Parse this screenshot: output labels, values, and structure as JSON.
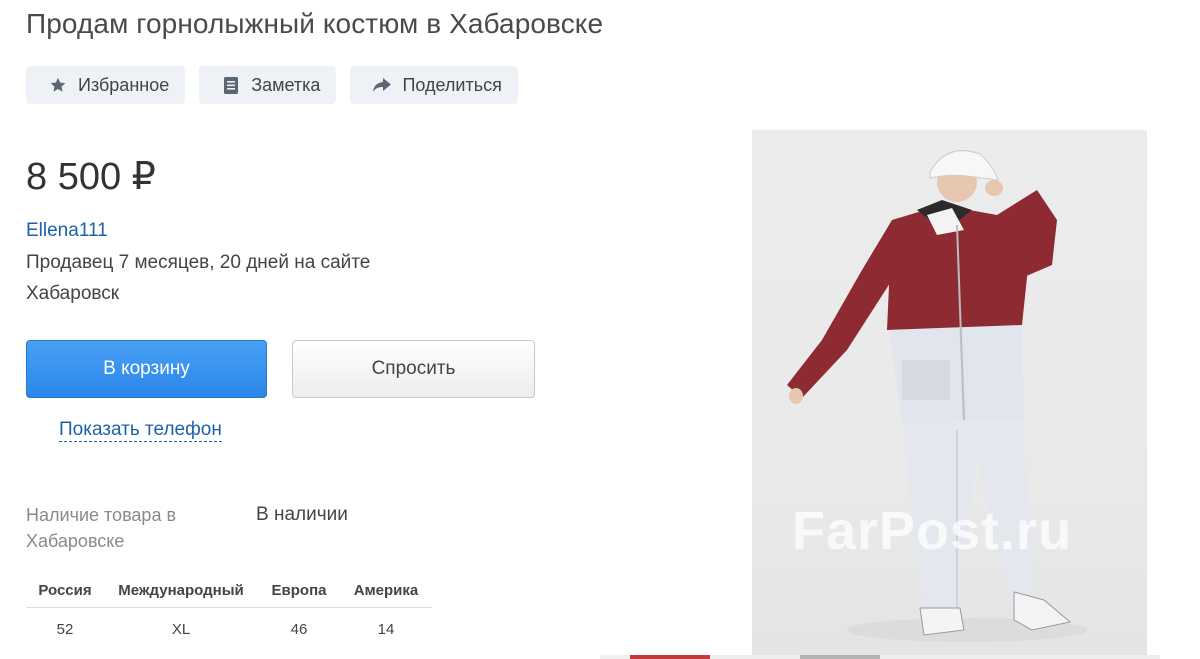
{
  "listing": {
    "title": "Продам горнолыжный костюм в Хабаровске",
    "price": "8 500 ₽",
    "seller_name": "Ellena111",
    "seller_since": "Продавец 7 месяцев, 20 дней на сайте",
    "city": "Хабаровск"
  },
  "actions": {
    "favorite_label": "Избранное",
    "note_label": "Заметка",
    "share_label": "Поделиться"
  },
  "buttons": {
    "cart_label": "В корзину",
    "ask_label": "Спросить",
    "phone_label": "Показать телефон"
  },
  "availability": {
    "label": "Наличие товара в Хабаровске",
    "value": "В наличии"
  },
  "size_table": {
    "headers": [
      "Россия",
      "Международный",
      "Европа",
      "Америка"
    ],
    "rows": [
      [
        "52",
        "XL",
        "46",
        "14"
      ]
    ]
  },
  "photo": {
    "watermark": "FarPost.ru"
  },
  "colors": {
    "link": "#1d61a6",
    "primary_button": "#2c86e8",
    "jacket_red": "#8e2a31",
    "jacket_white": "#dfe3ec"
  },
  "icons": [
    "star-icon",
    "note-icon",
    "share-arrow-icon"
  ]
}
